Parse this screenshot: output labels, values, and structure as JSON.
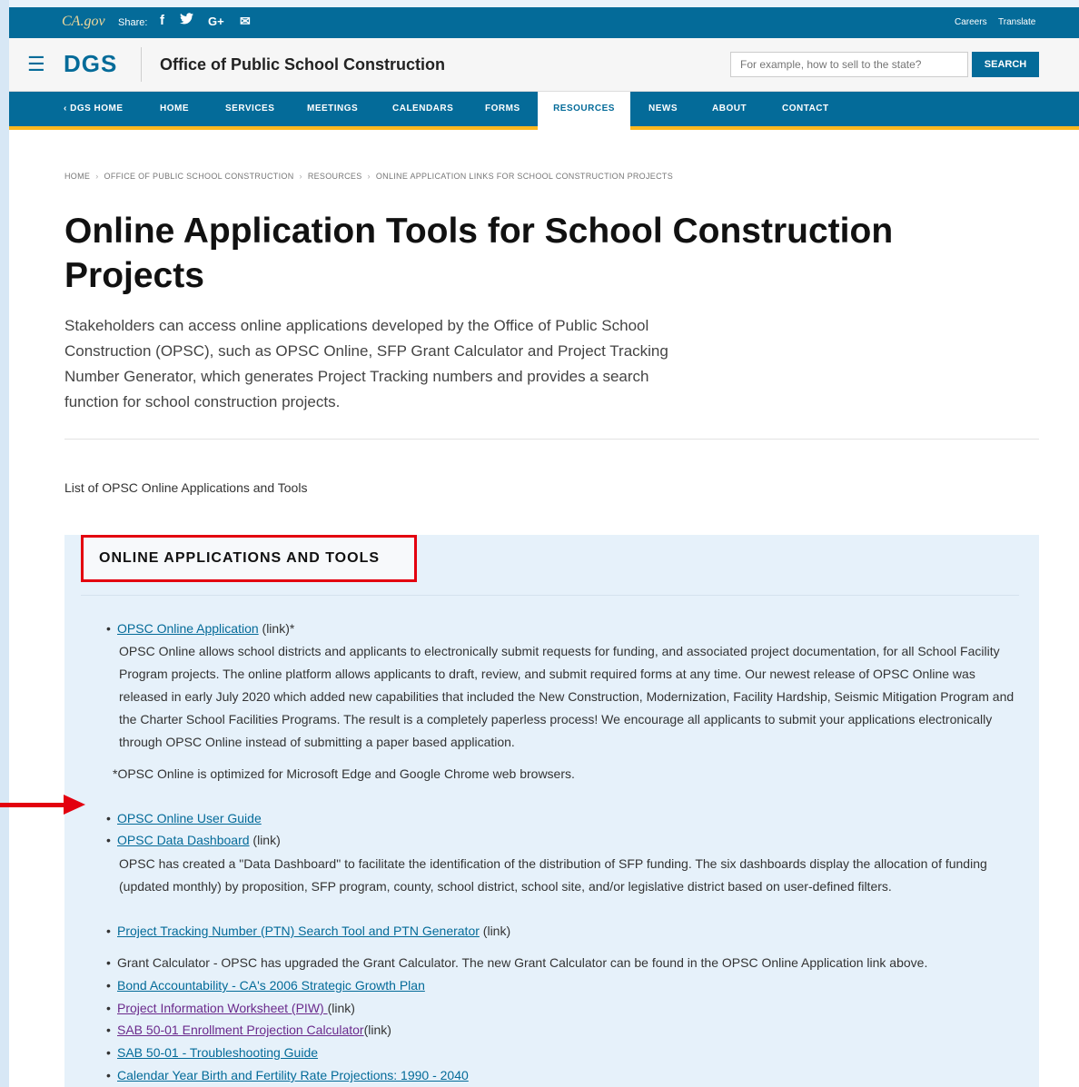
{
  "utility": {
    "logo_text": "CA.gov",
    "share_label": "Share:",
    "social": [
      {
        "name": "facebook",
        "glyph": "f"
      },
      {
        "name": "twitter",
        "glyph": "🐦"
      },
      {
        "name": "google-plus",
        "glyph": "G+"
      },
      {
        "name": "email",
        "glyph": "✉"
      }
    ],
    "careers": "Careers",
    "translate": "Translate"
  },
  "header": {
    "logo": "DGS",
    "title": "Office of Public School Construction",
    "search_placeholder": "For example, how to sell to the state?",
    "search_button": "SEARCH"
  },
  "nav": {
    "items": [
      {
        "label": "‹ DGS HOME"
      },
      {
        "label": "HOME"
      },
      {
        "label": "SERVICES"
      },
      {
        "label": "MEETINGS"
      },
      {
        "label": "CALENDARS"
      },
      {
        "label": "FORMS"
      },
      {
        "label": "RESOURCES"
      },
      {
        "label": "NEWS"
      },
      {
        "label": "ABOUT"
      },
      {
        "label": "CONTACT"
      }
    ]
  },
  "breadcrumb": [
    "HOME",
    "OFFICE OF PUBLIC SCHOOL CONSTRUCTION",
    "RESOURCES",
    "ONLINE APPLICATION LINKS FOR SCHOOL CONSTRUCTION PROJECTS"
  ],
  "main": {
    "title": "Online Application Tools for School Construction Projects",
    "intro": "Stakeholders can access online applications developed by the Office of Public School Construction (OPSC), such as OPSC Online, SFP Grant Calculator and Project Tracking Number Generator, which generates Project Tracking numbers and provides a search function for school construction projects.",
    "list_label": "List of OPSC Online Applications and Tools"
  },
  "panel": {
    "heading": "ONLINE APPLICATIONS AND TOOLS",
    "items": {
      "opsc_online": {
        "link": "OPSC Online Application",
        "suffix": " (link)*",
        "desc": "OPSC Online allows school districts and applicants to electronically submit requests for funding, and associated project documentation, for all School Facility Program projects. The online platform allows applicants to draft, review, and submit required forms at any time. Our newest release of OPSC Online was released in early July 2020 which added new capabilities that included the New Construction, Modernization, Facility Hardship, Seismic Mitigation Program and the Charter School Facilities Programs. The result is a completely paperless process! We encourage all applicants to submit your applications electronically through OPSC Online instead of submitting a paper based application.",
        "note": "*OPSC Online is optimized for Microsoft Edge and Google Chrome web browsers."
      },
      "user_guide": {
        "link": "OPSC Online User Guide"
      },
      "dashboard": {
        "link": "OPSC Data Dashboard",
        "suffix": " (link)",
        "desc": "OPSC has created a \"Data Dashboard\" to facilitate the identification of the distribution of SFP funding. The six dashboards display the allocation of funding (updated monthly) by proposition, SFP program, county, school district, school site, and/or legislative district based on user-defined filters."
      },
      "ptn": {
        "link": "Project Tracking Number (PTN) Search Tool and PTN Generator",
        "suffix": " (link)"
      },
      "grant_calc": {
        "text": "Grant Calculator - OPSC has upgraded the Grant Calculator. The new Grant Calculator can be found in the OPSC Online Application link above."
      },
      "bond": {
        "link": "Bond Accountability - CA's 2006 Strategic Growth Plan"
      },
      "piw": {
        "link": "Project Information Worksheet (PIW) ",
        "suffix": "(link)"
      },
      "sab_calc": {
        "link": "SAB 50-01 Enrollment Projection Calculator",
        "suffix": "(link)"
      },
      "sab_guide": {
        "link": "SAB 50-01 - Troubleshooting Guide"
      },
      "birth": {
        "link": "Calendar Year Birth and Fertility Rate Projections: 1990 - 2040"
      }
    }
  },
  "colors": {
    "brand_blue": "#046b99",
    "accent_gold": "#fdb81e",
    "highlight_red": "#e3000f"
  }
}
